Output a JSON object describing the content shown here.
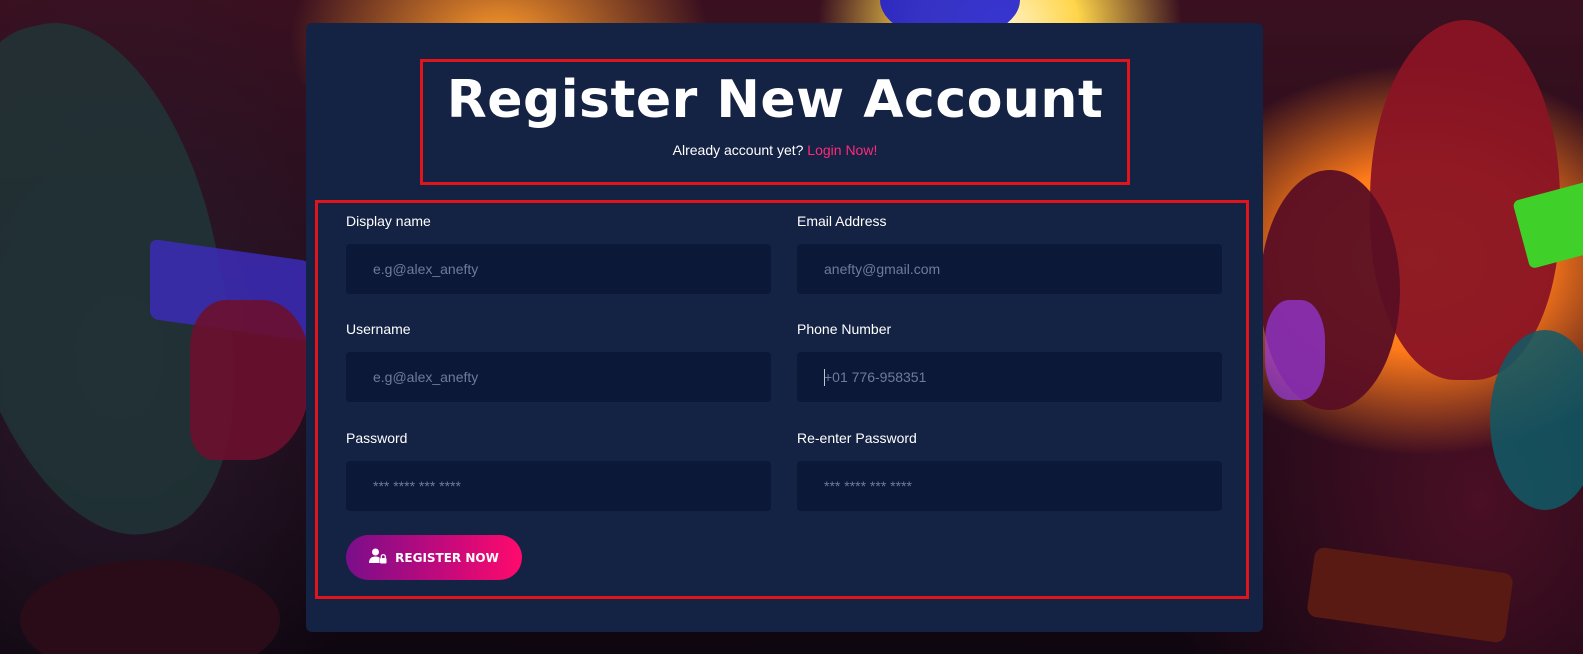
{
  "header": {
    "title": "Register New Account",
    "prompt_text": "Already account yet?",
    "login_link": "Login Now!"
  },
  "form": {
    "fields": [
      {
        "label": "Display name",
        "placeholder": "e.g@alex_anefty",
        "value": ""
      },
      {
        "label": "Email Address",
        "placeholder": "anefty@gmail.com",
        "value": ""
      },
      {
        "label": "Username",
        "placeholder": "e.g@alex_anefty",
        "value": ""
      },
      {
        "label": "Phone Number",
        "placeholder": "+01 776-958351",
        "value": ""
      },
      {
        "label": "Password",
        "placeholder": "*** **** *** ****",
        "value": ""
      },
      {
        "label": "Re-enter Password",
        "placeholder": "*** **** *** ****",
        "value": ""
      }
    ],
    "submit_label": "REGISTER NOW",
    "submit_icon": "user-lock-icon"
  },
  "colors": {
    "card": "#142243",
    "input_bg": "#0b1838",
    "accent_link": "#ff2a7a",
    "button_gradient_start": "#7a0e8a",
    "button_gradient_end": "#ff0a6c",
    "highlight_border": "#e0141b"
  }
}
